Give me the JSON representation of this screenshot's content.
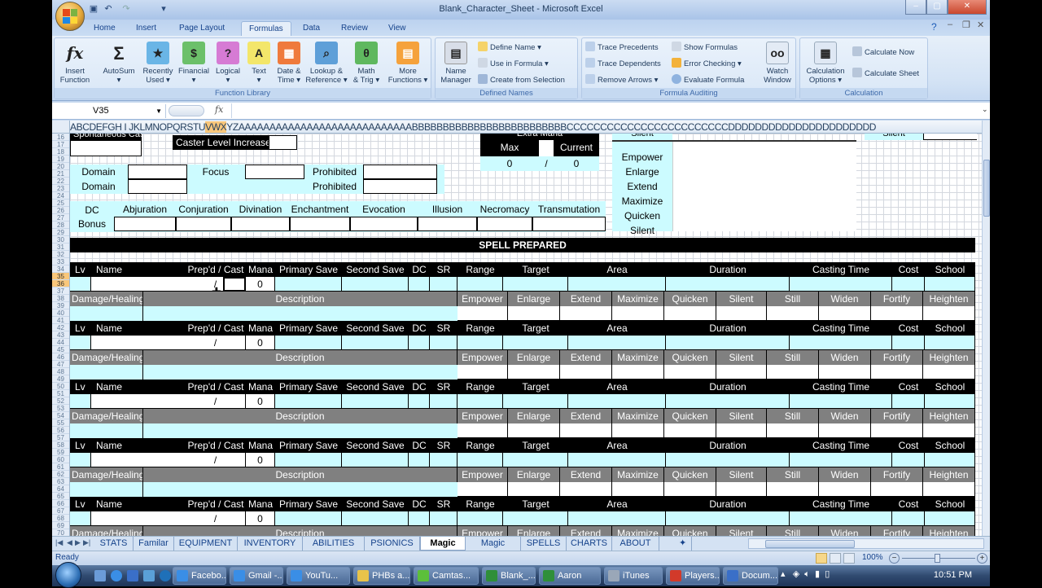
{
  "window": {
    "title": "Blank_Character_Sheet - Microsoft Excel",
    "controls": {
      "minimize": "–",
      "maximize": "▢",
      "close": "✕"
    }
  },
  "quick_access": {
    "save": "save-icon",
    "undo": "undo-icon",
    "redo": "redo-icon",
    "customize": "▾"
  },
  "ribbon_tabs": [
    {
      "label": "Home"
    },
    {
      "label": "Insert"
    },
    {
      "label": "Page Layout"
    },
    {
      "label": "Formulas",
      "active": true
    },
    {
      "label": "Data"
    },
    {
      "label": "Review"
    },
    {
      "label": "View"
    }
  ],
  "ribbon": {
    "function_library": {
      "label": "Function Library",
      "buttons": [
        {
          "label1": "Insert",
          "label2": "Function",
          "glyph": "fx"
        },
        {
          "label1": "AutoSum",
          "label2": "▾",
          "glyph": "Σ"
        },
        {
          "label1": "Recently",
          "label2": "Used ▾",
          "glyph": "★"
        },
        {
          "label1": "Financial",
          "label2": "▾",
          "glyph": "$"
        },
        {
          "label1": "Logical",
          "label2": "▾",
          "glyph": "?"
        },
        {
          "label1": "Text",
          "label2": "▾",
          "glyph": "A"
        },
        {
          "label1": "Date &",
          "label2": "Time ▾",
          "glyph": "▦"
        },
        {
          "label1": "Lookup &",
          "label2": "Reference ▾",
          "glyph": "⌕"
        },
        {
          "label1": "Math",
          "label2": "& Trig ▾",
          "glyph": "θ"
        },
        {
          "label1": "More",
          "label2": "Functions ▾",
          "glyph": "▤"
        }
      ]
    },
    "defined_names": {
      "label": "Defined Names",
      "name_manager": {
        "label1": "Name",
        "label2": "Manager"
      },
      "define_name": "Define Name ▾",
      "use_in_formula": "Use in Formula ▾",
      "create_from_selection": "Create from Selection"
    },
    "formula_auditing": {
      "label": "Formula Auditing",
      "trace_precedents": "Trace Precedents",
      "trace_dependents": "Trace Dependents",
      "remove_arrows": "Remove Arrows ▾",
      "show_formulas": "Show Formulas",
      "error_checking": "Error Checking ▾",
      "evaluate_formula": "Evaluate Formula",
      "watch_window": {
        "label1": "Watch",
        "label2": "Window"
      }
    },
    "calculation": {
      "label": "Calculation",
      "calc_options": {
        "label1": "Calculation",
        "label2": "Options ▾"
      },
      "calculate_now": "Calculate Now",
      "calculate_sheet": "Calculate Sheet"
    }
  },
  "formula_bar": {
    "name_box": "V35",
    "fx": "fx",
    "formula": ""
  },
  "column_headers": {
    "before": "ABCDEFGH I JKLMNOPQRSTU",
    "selected": "VWX",
    "after": "YZAAAAAAAAAAAAAAAAAAAAAAAAAAAABBBBBBBBBBBBBBBBBBBBBBBBBCCCCCCCCCCCCCCCCCCCCCCCCDDDDDDDDDDDDDDDDDDDDDD"
  },
  "row_headers": {
    "rows": [
      "16",
      "17",
      "18",
      "19",
      "20",
      "21",
      "22",
      "23",
      "24",
      "25",
      "26",
      "27",
      "28",
      "29",
      "30",
      "31",
      "32",
      "33",
      "34",
      "35",
      "36",
      "37",
      "38",
      "39",
      "40",
      "41",
      "42",
      "43",
      "44",
      "45",
      "46",
      "47",
      "48",
      "49",
      "50",
      "51",
      "52",
      "53",
      "54",
      "55",
      "56",
      "57",
      "58",
      "59",
      "60",
      "61",
      "62",
      "63",
      "64",
      "65",
      "66",
      "67",
      "68",
      "69",
      "70"
    ],
    "selected": [
      "35",
      "36"
    ]
  },
  "sheet": {
    "spontaneous_caster": "Spontaneous Caster",
    "caster_level_increase": "Caster Level Increase",
    "extra_mana": {
      "title": "Extra Mana",
      "max_label": "Max",
      "current_label": "Current",
      "max": "0",
      "sep": "/",
      "current": "0"
    },
    "domain_label": "Domain",
    "focus_label": "Focus",
    "prohibited_label": "Prohibited",
    "dc_label": "DC",
    "bonus_label": "Bonus",
    "schools": [
      "Abjuration",
      "Conjuration",
      "Divination",
      "Enchantment",
      "Evocation",
      "Illusion",
      "Necromacy",
      "Transmutation"
    ],
    "metamagic_list": [
      "Silent",
      "Empower",
      "Enlarge",
      "Extend",
      "Maximize",
      "Quicken",
      "Silent"
    ],
    "right_silent": "Silent",
    "spell_prepared_title": "SPELL PREPARED",
    "spell_header": {
      "lv": "Lv",
      "name": "Name",
      "prepd_cast": "Prep'd / Cast",
      "mana": "Mana",
      "primary_save": "Primary Save",
      "second_save": "Second Save",
      "dc": "DC",
      "sr": "SR",
      "range": "Range",
      "target": "Target",
      "area": "Area",
      "duration": "Duration",
      "casting_time": "Casting Time",
      "cost": "Cost",
      "school": "School"
    },
    "detail_header": {
      "damage_healing": "Damage/Healing",
      "description": "Description",
      "metamagic": [
        "Empower",
        "Enlarge",
        "Extend",
        "Maximize",
        "Quicken",
        "Silent",
        "Still",
        "Widen",
        "Fortify",
        "Heighten"
      ]
    },
    "spell_blocks": [
      {
        "prep_sep": "/",
        "mana": "0"
      },
      {
        "prep_sep": "/",
        "mana": "0"
      },
      {
        "prep_sep": "/",
        "mana": "0"
      },
      {
        "prep_sep": "/",
        "mana": "0"
      },
      {
        "prep_sep": "/",
        "mana": "0"
      }
    ]
  },
  "sheet_tabs": [
    {
      "label": "STATS"
    },
    {
      "label": "Familar"
    },
    {
      "label": "EQUIPMENT"
    },
    {
      "label": "INVENTORY"
    },
    {
      "label": "ABILITIES"
    },
    {
      "label": "PSIONICS"
    },
    {
      "label": "Magic",
      "active": true
    },
    {
      "label": "Magic (Simple)"
    },
    {
      "label": "SPELLS"
    },
    {
      "label": "CHARTS"
    },
    {
      "label": "ABOUT"
    }
  ],
  "status_bar": {
    "status": "Ready",
    "zoom": "100%"
  },
  "taskbar": {
    "tasks": [
      {
        "label": "Facebo...",
        "color": "#3a8ee6"
      },
      {
        "label": "Gmail -...",
        "color": "#3a8ee6"
      },
      {
        "label": "YouTu...",
        "color": "#3a8ee6"
      },
      {
        "label": "PHBs a...",
        "color": "#e8c34a"
      },
      {
        "label": "Camtas...",
        "color": "#5cbf3a"
      },
      {
        "label": "Blank_...",
        "color": "#2f8f3a"
      },
      {
        "label": "Aaron",
        "color": "#2f8f3a"
      },
      {
        "label": "iTunes",
        "color": "#9aa7b8"
      },
      {
        "label": "Players...",
        "color": "#d23a2a"
      },
      {
        "label": "Docum...",
        "color": "#3a6fc8"
      }
    ],
    "clock": "10:51 PM"
  }
}
